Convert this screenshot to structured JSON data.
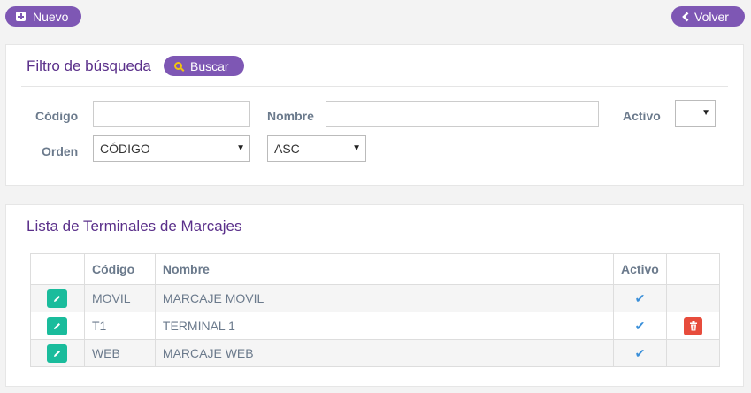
{
  "toolbar": {
    "nuevo_label": "Nuevo",
    "volver_label": "Volver"
  },
  "filter": {
    "title": "Filtro de búsqueda",
    "buscar_label": "Buscar",
    "codigo_label": "Código",
    "codigo_value": "",
    "nombre_label": "Nombre",
    "nombre_value": "",
    "activo_label": "Activo",
    "activo_value": "",
    "orden_label": "Orden",
    "orden_value": "CÓDIGO",
    "direction_value": "ASC"
  },
  "list": {
    "title": "Lista de Terminales de Marcajes",
    "columns": [
      "",
      "Código",
      "Nombre",
      "Activo",
      ""
    ],
    "rows": [
      {
        "codigo": "MOVIL",
        "nombre": "MARCAJE MOVIL",
        "activo": true,
        "deletable": false
      },
      {
        "codigo": "T1",
        "nombre": "TERMINAL 1",
        "activo": true,
        "deletable": true
      },
      {
        "codigo": "WEB",
        "nombre": "MARCAJE WEB",
        "activo": true,
        "deletable": false
      }
    ]
  },
  "colors": {
    "accent": "#7e57b4",
    "edit": "#1abc9c",
    "delete": "#e74c3c",
    "check": "#3a8fd9"
  }
}
